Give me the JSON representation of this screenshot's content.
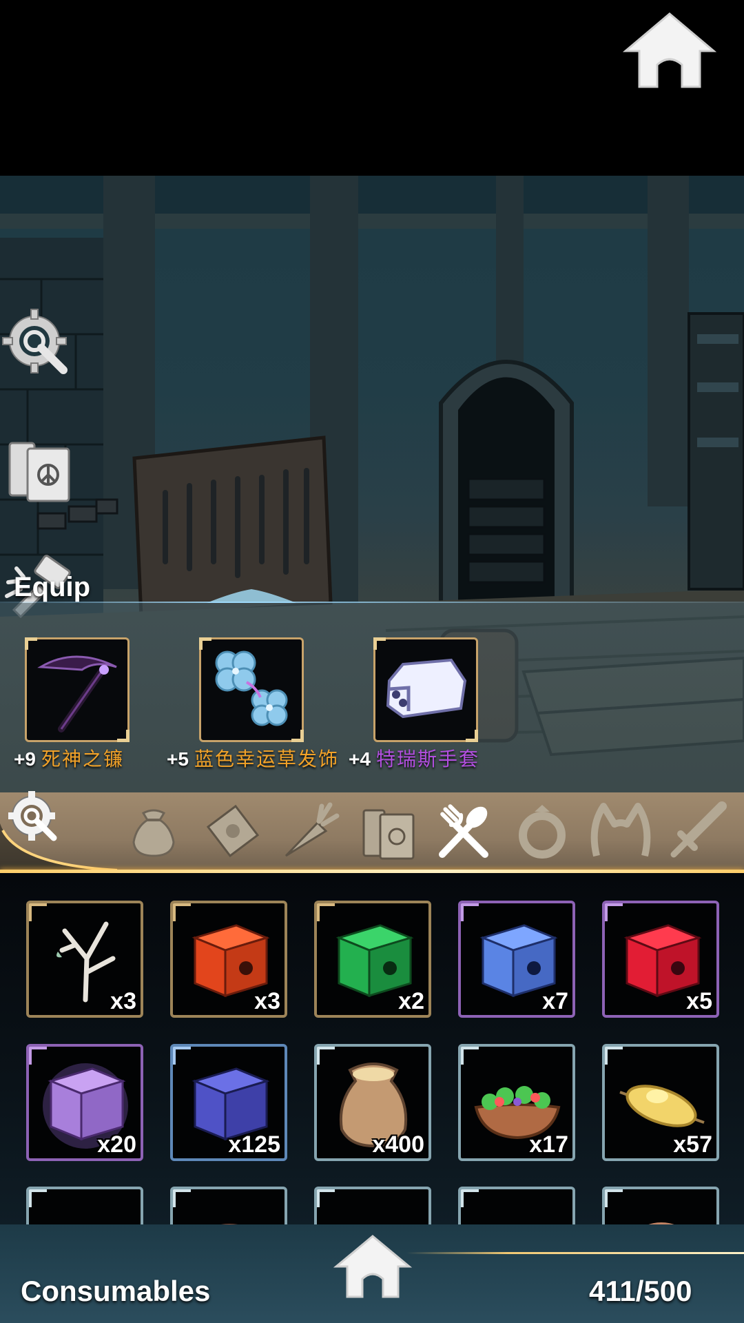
{
  "equip_title": "Equip",
  "equipped": [
    {
      "level": "+9",
      "name": "死神之镰",
      "color": "#f2a228",
      "icon": "scythe-icon"
    },
    {
      "level": "+5",
      "name": "蓝色幸运草发饰",
      "color": "#f2a228",
      "icon": "clover-hairpin-icon"
    },
    {
      "level": "+4",
      "name": "特瑞斯手套",
      "color": "#b34fe0",
      "icon": "gauntlet-icon"
    }
  ],
  "side_buttons": [
    "settings-search-icon",
    "codex-books-icon",
    "forge-icon"
  ],
  "tabs": [
    {
      "icon": "filter-settings-icon",
      "active": false
    },
    {
      "icon": "bag-icon",
      "active": false
    },
    {
      "icon": "scroll-icon",
      "active": false
    },
    {
      "icon": "carrot-icon",
      "active": false
    },
    {
      "icon": "books-icon",
      "active": false
    },
    {
      "icon": "utensils-icon",
      "active": true
    },
    {
      "icon": "ring-icon",
      "active": false
    },
    {
      "icon": "cat-ear-headband-icon",
      "active": false
    },
    {
      "icon": "sword-icon",
      "active": false
    }
  ],
  "items": [
    {
      "qty": "x3",
      "rarity": "gold",
      "icon": "branch-icon"
    },
    {
      "qty": "x3",
      "rarity": "gold",
      "icon": "orange-box-icon"
    },
    {
      "qty": "x2",
      "rarity": "gold",
      "icon": "green-box-icon"
    },
    {
      "qty": "x7",
      "rarity": "purple",
      "icon": "blue-box-icon"
    },
    {
      "qty": "x5",
      "rarity": "purple",
      "icon": "red-box-icon"
    },
    {
      "qty": "x20",
      "rarity": "purple",
      "icon": "purple-box-icon"
    },
    {
      "qty": "x125",
      "rarity": "blue",
      "icon": "indigo-box-icon"
    },
    {
      "qty": "x400",
      "rarity": "steel",
      "icon": "flour-sack-icon"
    },
    {
      "qty": "x17",
      "rarity": "steel",
      "icon": "salad-bowl-icon"
    },
    {
      "qty": "x57",
      "rarity": "steel",
      "icon": "grilled-corn-icon"
    },
    {
      "qty": "",
      "rarity": "steel",
      "icon": "empty-slot"
    },
    {
      "qty": "",
      "rarity": "steel",
      "icon": "food-item-icon"
    },
    {
      "qty": "",
      "rarity": "steel",
      "icon": "empty-slot"
    },
    {
      "qty": "",
      "rarity": "steel",
      "icon": "empty-slot"
    },
    {
      "qty": "",
      "rarity": "steel",
      "icon": "meat-item-icon"
    }
  ],
  "category_label": "Consumables",
  "capacity": "411/500",
  "colors": {
    "accent_gold": "#f2c36c",
    "rarity_gold": "#9d8458",
    "rarity_purple": "#8d62b5",
    "rarity_blue": "#5e88b8",
    "rarity_steel": "#86a5b0"
  }
}
